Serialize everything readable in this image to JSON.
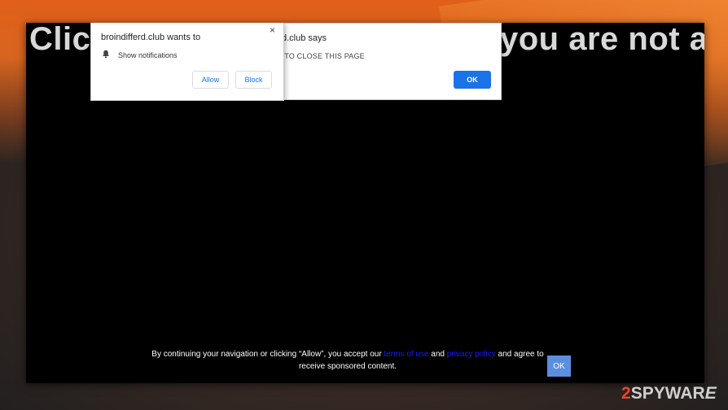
{
  "background": {
    "accent_top": "#e0601a",
    "accent_bottom": "#1e1e1e"
  },
  "page": {
    "headline_left": "Clic",
    "headline_right": "you are not a"
  },
  "alert_dialog": {
    "title": "d.club says",
    "message": "W TO CLOSE THIS PAGE",
    "ok_label": "OK",
    "ok_color": "#1a73e8"
  },
  "notification_prompt": {
    "title": "broindifferd.club wants to",
    "permission": "Show notifications",
    "allow_label": "Allow",
    "block_label": "Block",
    "close_glyph": "×",
    "icon": "bell-icon"
  },
  "consent_banner": {
    "text_1": "By continuing your navigation or clicking “Allow”, you accept our ",
    "terms_link": "terms of use",
    "text_2": " and ",
    "privacy_link": "privacy policy",
    "text_3": " and agree to receive sponsored content.",
    "ok_label": "OK",
    "link_color": "#1a1aff"
  },
  "watermark": {
    "part_1": "2",
    "part_2": "SPYWAR",
    "part_3": "E"
  }
}
